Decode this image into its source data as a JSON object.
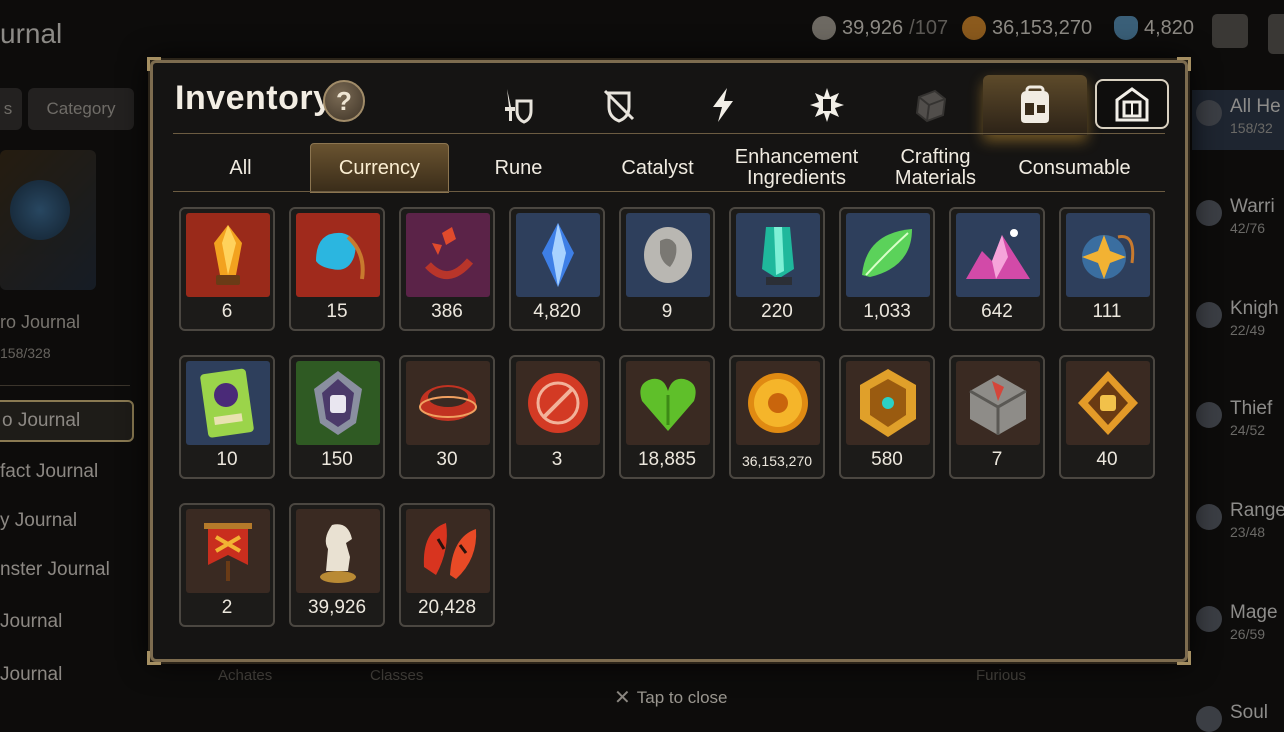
{
  "background": {
    "title": "urnal",
    "resources": [
      {
        "icon": "horse-token-icon",
        "value": "39,926",
        "suffix": "/107"
      },
      {
        "icon": "gold-coin-icon",
        "value": "36,153,270",
        "suffix": ""
      },
      {
        "icon": "blue-crystal-icon",
        "value": "4,820",
        "suffix": ""
      }
    ],
    "left_tabs": [
      "s",
      "Category"
    ],
    "journal": {
      "title": "ro Journal",
      "count": "158/328"
    },
    "nav": [
      "o Journal",
      "fact Journal",
      "y Journal",
      "nster Journal",
      "Journal",
      "Journal"
    ],
    "right": [
      {
        "name": "All He",
        "count": "158/32"
      },
      {
        "name": "Warri",
        "count": "42/76"
      },
      {
        "name": "Knigh",
        "count": "22/49"
      },
      {
        "name": "Thief",
        "count": "24/52"
      },
      {
        "name": "Range",
        "count": "23/48"
      },
      {
        "name": "Mage",
        "count": "26/59"
      },
      {
        "name": "Soul",
        "count": ""
      }
    ],
    "bottom_labels": [
      "Achates",
      "Classes",
      "Furious"
    ],
    "tap_close": "Tap to close"
  },
  "modal": {
    "title": "Inventory",
    "help_label": "?",
    "category_icons": [
      "equipment-icon",
      "no-shield-icon",
      "lightning-icon",
      "artifact-icon",
      "box-icon",
      "bag-icon",
      "storage-icon"
    ],
    "sub_tabs": [
      {
        "label": "All",
        "active": false
      },
      {
        "label": "Currency",
        "active": true
      },
      {
        "label": "Rune",
        "active": false
      },
      {
        "label": "Catalyst",
        "active": false
      },
      {
        "label": "Enhancement Ingredients",
        "active": false
      },
      {
        "label": "Crafting Materials",
        "active": false
      },
      {
        "label": "Consumable",
        "active": false
      }
    ],
    "items": [
      {
        "icon": "orange-crystal-icon",
        "qty": "6"
      },
      {
        "icon": "blue-pendant-icon",
        "qty": "15"
      },
      {
        "icon": "red-ring-charm-icon",
        "qty": "386"
      },
      {
        "icon": "blue-gem-icon",
        "qty": "4,820"
      },
      {
        "icon": "silver-coin-icon",
        "qty": "9"
      },
      {
        "icon": "teal-crystal-icon",
        "qty": "220"
      },
      {
        "icon": "green-leaf-icon",
        "qty": "1,033"
      },
      {
        "icon": "pink-crystal-pile-icon",
        "qty": "642"
      },
      {
        "icon": "gold-star-pendant-icon",
        "qty": "111"
      },
      {
        "icon": "summon-card-icon",
        "qty": "10"
      },
      {
        "icon": "fist-emblem-icon",
        "qty": "150"
      },
      {
        "icon": "red-ring-icon",
        "qty": "30"
      },
      {
        "icon": "red-seal-icon",
        "qty": "3"
      },
      {
        "icon": "green-heart-icon",
        "qty": "18,885"
      },
      {
        "icon": "gold-sun-coin-icon",
        "qty": "36,153,270"
      },
      {
        "icon": "gold-shield-icon",
        "qty": "580"
      },
      {
        "icon": "stone-cube-icon",
        "qty": "7"
      },
      {
        "icon": "gold-fist-badge-icon",
        "qty": "40"
      },
      {
        "icon": "red-banner-icon",
        "qty": "2"
      },
      {
        "icon": "silver-horse-icon",
        "qty": "39,926"
      },
      {
        "icon": "red-leaf-icon",
        "qty": "20,428"
      }
    ]
  },
  "colors": {
    "frame": "#7d6c4f",
    "active_tab": "#6a5330",
    "panel": "#151413"
  }
}
